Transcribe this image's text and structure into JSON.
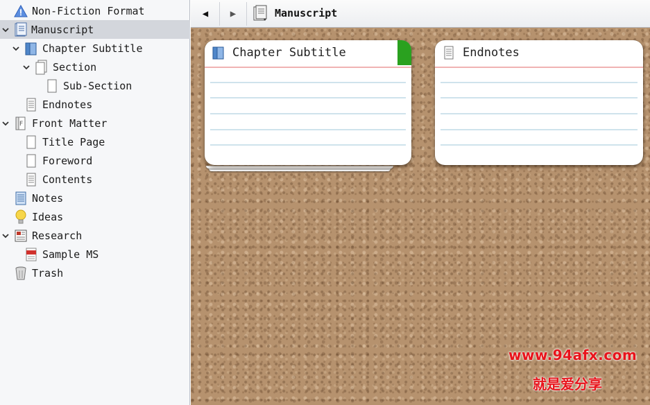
{
  "binder": {
    "items": [
      {
        "label": "Non-Fiction Format",
        "icon": "info-icon"
      },
      {
        "label": "Manuscript",
        "icon": "manuscript-icon",
        "expanded": true,
        "selected": true
      },
      {
        "label": "Chapter Subtitle",
        "icon": "folder-book-icon",
        "expanded": true
      },
      {
        "label": "Section",
        "icon": "document-stack-icon",
        "expanded": true
      },
      {
        "label": "Sub-Section",
        "icon": "blank-page-icon"
      },
      {
        "label": "Endnotes",
        "icon": "text-page-icon"
      },
      {
        "label": "Front Matter",
        "icon": "front-matter-icon",
        "expanded": true
      },
      {
        "label": "Title Page",
        "icon": "blank-page-icon"
      },
      {
        "label": "Foreword",
        "icon": "blank-page-icon"
      },
      {
        "label": "Contents",
        "icon": "text-page-icon"
      },
      {
        "label": "Notes",
        "icon": "notebook-icon"
      },
      {
        "label": "Ideas",
        "icon": "lightbulb-icon"
      },
      {
        "label": "Research",
        "icon": "research-icon",
        "expanded": true
      },
      {
        "label": "Sample MS",
        "icon": "pdf-icon"
      },
      {
        "label": "Trash",
        "icon": "trash-icon"
      }
    ]
  },
  "header": {
    "back_glyph": "◀",
    "forward_glyph": "▶",
    "title": "Manuscript",
    "icon": "manuscript-icon"
  },
  "corkboard": {
    "cards": [
      {
        "title": "Chapter Subtitle",
        "icon": "folder-book-icon",
        "label_color": "#2aa11f"
      },
      {
        "title": "Endnotes",
        "icon": "text-page-icon"
      }
    ]
  },
  "watermark": {
    "line1": "www.94afx.com",
    "line2": "就是爱分享",
    "color": "#e8141c"
  },
  "colors": {
    "binder_bg": "#f6f7f9",
    "selection": "#d3d6dc",
    "cork": "#b6926e"
  }
}
